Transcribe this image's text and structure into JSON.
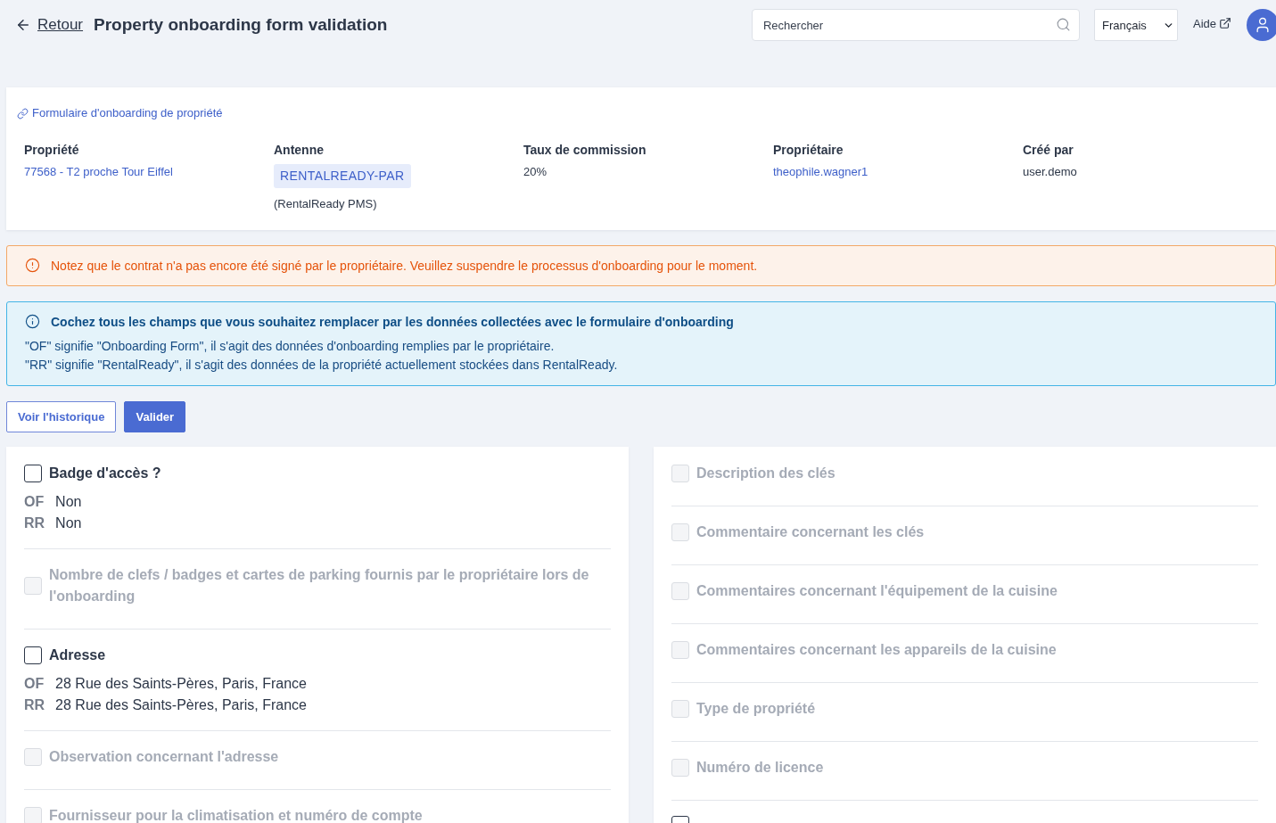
{
  "header": {
    "back_link": "Retour",
    "title": "Property onboarding form validation",
    "search": {
      "placeholder": "Rechercher"
    },
    "language_select": {
      "value": "Français"
    },
    "help_link": "Aide"
  },
  "property_card": {
    "form_link": "Formulaire d'onboarding de propriété",
    "fields": [
      {
        "label": "Propriété",
        "kind": "link",
        "value": "77568 - T2 proche Tour Eiffel"
      },
      {
        "label": "Antenne",
        "kind": "badge",
        "value": "RENTALREADY-PAR",
        "note": "(RentalReady PMS)"
      },
      {
        "label": "Taux de commission",
        "kind": "text",
        "value": "20%"
      },
      {
        "label": "Propriétaire",
        "kind": "link",
        "value": "theophile.wagner1"
      },
      {
        "label": "Créé par",
        "kind": "text",
        "value": "user.demo"
      }
    ]
  },
  "alerts": [
    {
      "kind": "warning",
      "title": "Notez que le contrat n'a pas encore été signé par le propriétaire. Veuillez suspendre le processus d'onboarding pour le moment."
    },
    {
      "kind": "info",
      "title": "Cochez tous les champs que vous souhaitez remplacer par les données collectées avec le formulaire d'onboarding",
      "lines": [
        "\"OF\" signifie \"Onboarding Form\", il s'agit des données d'onboarding remplies par le propriétaire.",
        "\"RR\" signifie \"RentalReady\", il s'agit des données de la propriété actuellement stockées dans RentalReady."
      ]
    }
  ],
  "actions": [
    {
      "label": "Voir l'historique",
      "kind": "outline"
    },
    {
      "label": "Valider",
      "kind": "primary"
    }
  ],
  "columns": [
    {
      "items": [
        {
          "label": "Badge d'accès ?",
          "checked": false,
          "disabled": false,
          "values": [
            {
              "source": "OF",
              "value": "Non"
            },
            {
              "source": "RR",
              "value": "Non"
            }
          ]
        },
        {
          "label": "Nombre de clefs / badges et cartes de parking fournis par le propriétaire lors de l'onboarding",
          "checked": false,
          "disabled": true
        },
        {
          "label": "Adresse",
          "checked": false,
          "disabled": false,
          "values": [
            {
              "source": "OF",
              "value": "28 Rue des Saints-Pères, Paris, France"
            },
            {
              "source": "RR",
              "value": "28 Rue des Saints-Pères, Paris, France"
            }
          ]
        },
        {
          "label": "Observation concernant l'adresse",
          "checked": false,
          "disabled": true
        },
        {
          "label": "Fournisseur pour la climatisation et numéro de compte",
          "checked": false,
          "disabled": true
        }
      ]
    },
    {
      "items": [
        {
          "label": "Description des clés",
          "checked": false,
          "disabled": true
        },
        {
          "label": "Commentaire concernant les clés",
          "checked": false,
          "disabled": true
        },
        {
          "label": "Commentaires concernant l'équipement de la cuisine",
          "checked": false,
          "disabled": true
        },
        {
          "label": "Commentaires concernant les appareils de la cuisine",
          "checked": false,
          "disabled": true
        },
        {
          "label": "Type de propriété",
          "checked": false,
          "disabled": true
        },
        {
          "label": "Numéro de licence",
          "checked": false,
          "disabled": true
        },
        {
          "checked": false,
          "disabled": false
        }
      ]
    }
  ]
}
